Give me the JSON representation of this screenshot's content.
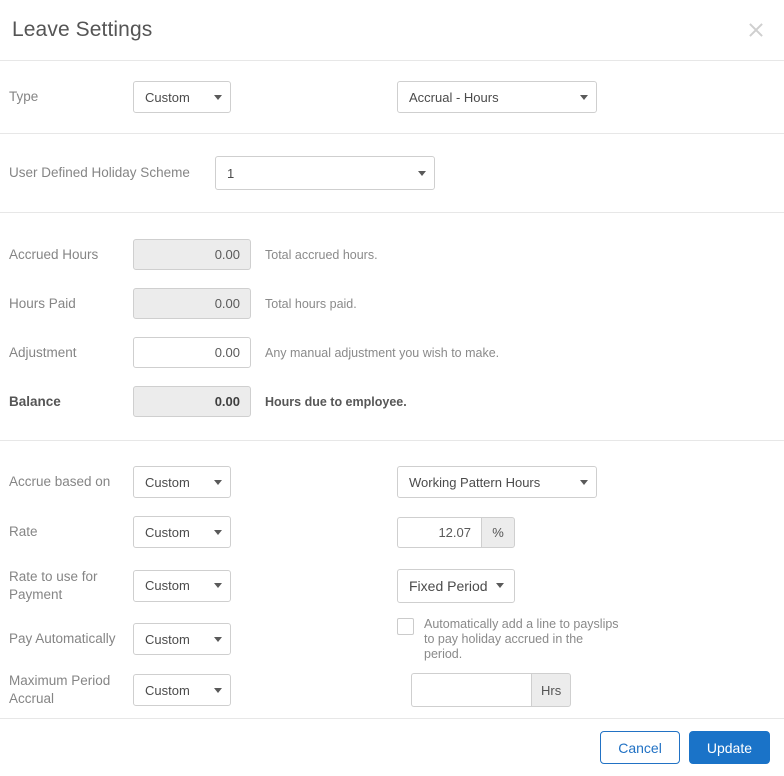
{
  "header": {
    "title": "Leave Settings",
    "close_icon": "close-icon"
  },
  "sections": {
    "type_row": {
      "label": "Type",
      "type_select": "Custom",
      "accrual_select": "Accrual - Hours"
    },
    "scheme_row": {
      "label": "User Defined Holiday Scheme",
      "value": "1"
    },
    "balances": [
      {
        "label": "Accrued Hours",
        "value": "0.00",
        "hint": "Total accrued hours.",
        "readonly": true,
        "bold": false
      },
      {
        "label": "Hours Paid",
        "value": "0.00",
        "hint": "Total hours paid.",
        "readonly": true,
        "bold": false
      },
      {
        "label": "Adjustment",
        "value": "0.00",
        "hint": "Any manual adjustment you wish to make.",
        "readonly": false,
        "bold": false
      },
      {
        "label": "Balance",
        "value": "0.00",
        "hint": "Hours due to employee.",
        "readonly": true,
        "bold": true
      }
    ],
    "accrual": {
      "accrue_based_on": {
        "label": "Accrue based on",
        "mode": "Custom",
        "value": "Working Pattern Hours"
      },
      "rate": {
        "label": "Rate",
        "mode": "Custom",
        "value": "12.07",
        "unit": "%"
      },
      "rate_for_payment": {
        "label": "Rate to use for Payment",
        "mode": "Custom",
        "value": "Fixed Period"
      },
      "pay_automatically": {
        "label": "Pay Automatically",
        "mode": "Custom",
        "checkbox_label": "Automatically add a line to payslips to pay holiday accrued in the period.",
        "checked": false
      },
      "maximum_period_accrual": {
        "label": "Maximum Period Accrual",
        "mode": "Custom",
        "value": "",
        "unit": "Hrs"
      }
    }
  },
  "footer": {
    "cancel_label": "Cancel",
    "update_label": "Update"
  },
  "colors": {
    "primary": "#1a73c8",
    "link": "#2272c4",
    "border": "#cfcfcf",
    "divider": "#e7e7e7",
    "readonly_bg": "#ececec",
    "label_text": "#858585"
  }
}
